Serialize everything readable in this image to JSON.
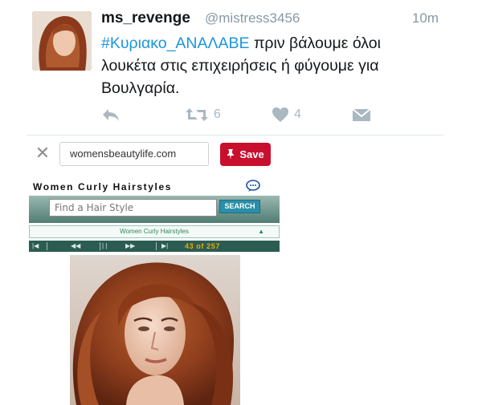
{
  "tweet": {
    "name": "ms_revenge",
    "handle": "@mistress3456",
    "time": "10m",
    "hashtag": "#Κυριακο_ΑΝΑΛΑΒΕ",
    "text": " πριν βάλουμε όλοι λουκέτα στις επιχειρήσεις ή φύγουμε για Βουλγαρία.",
    "retweet_count": "6",
    "like_count": "4"
  },
  "pin": {
    "url": "womensbeautylife.com",
    "save_label": "Save"
  },
  "site": {
    "title": "Women Curly Hairstyles",
    "search_placeholder": "Find a Hair Style",
    "search_button": "SEARCH",
    "category": "Women Curly Hairstyles",
    "pager_count": "43 of 257"
  },
  "colors": {
    "hashtag": "#1b95e0",
    "save_button": "#c8102e",
    "pager_count": "#f0a800"
  }
}
